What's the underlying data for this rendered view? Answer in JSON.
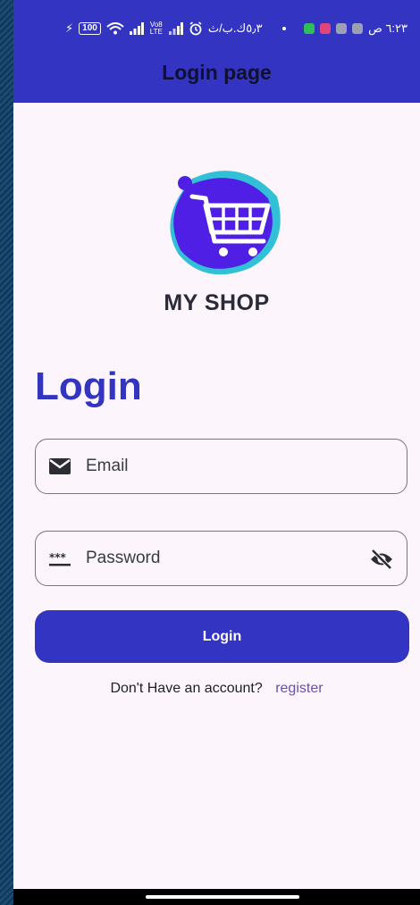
{
  "status_bar": {
    "time": "٦:٢٣ ص",
    "speed": "٥٫٣ك.ب/ث",
    "battery": "100",
    "network_label": "Vo8 LTE"
  },
  "app_bar": {
    "title": "Login page"
  },
  "brand": {
    "name": "MY SHOP"
  },
  "form": {
    "heading": "Login",
    "email": {
      "placeholder": "Email",
      "value": ""
    },
    "password": {
      "placeholder": "Password",
      "value": ""
    },
    "submit_label": "Login"
  },
  "signup": {
    "prompt": "Don't Have an account?",
    "link_label": "register"
  },
  "colors": {
    "primary": "#3335c2",
    "background": "#fcf6fc",
    "link": "#6a4fa8",
    "outline": "#76747e"
  }
}
